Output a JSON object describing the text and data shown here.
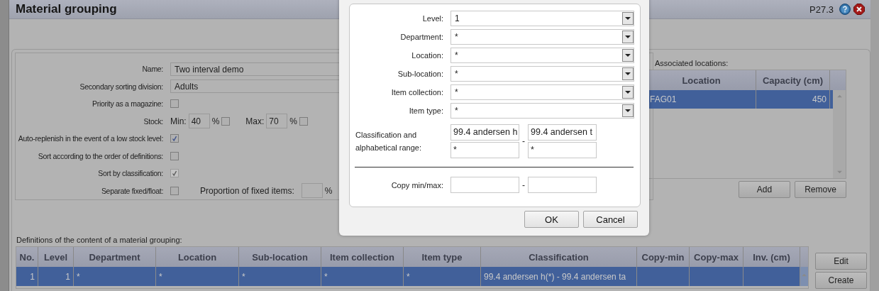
{
  "window": {
    "title": "Material grouping",
    "code": "P27.3"
  },
  "form": [
    {
      "kind": "text",
      "label": "Name:",
      "value": "Two interval demo"
    },
    {
      "kind": "text",
      "label": "Secondary sorting division:",
      "value": "Adults"
    },
    {
      "kind": "check",
      "label": "Priority as a magazine:",
      "checked": false,
      "disabled": false
    },
    {
      "kind": "stock",
      "label": "Stock:",
      "min_label": "Min:",
      "min": "40",
      "min_unit": "%",
      "min_checked": false,
      "max_label": "Max:",
      "max": "70",
      "max_unit": "%",
      "max_checked": false
    },
    {
      "kind": "check",
      "label": "Auto-replenish in the event of a low stock level:",
      "checked": true,
      "disabled": false
    },
    {
      "kind": "check",
      "label": "Sort according to the order of definitions:",
      "checked": false,
      "disabled": false
    },
    {
      "kind": "check",
      "label": "Sort by classification:",
      "checked": true,
      "disabled": true
    },
    {
      "kind": "fixed",
      "label": "Separate fixed/float:",
      "checked": false,
      "disabled": false,
      "proportion_label": "Proportion of fixed items:",
      "unit": "%"
    }
  ],
  "locations": {
    "label": "Associated locations:",
    "columns": [
      "Location",
      "Capacity (cm)"
    ],
    "rows": [
      {
        "cells": [
          "FAG01",
          "450"
        ],
        "selected": true
      }
    ],
    "buttons": [
      "Add",
      "Remove"
    ]
  },
  "definitions": {
    "label": "Definitions of the content of a material grouping:",
    "columns": [
      "No.",
      "Level",
      "Department",
      "Location",
      "Sub-location",
      "Item collection",
      "Item type",
      "Classification",
      "Copy-min",
      "Copy-max",
      "Inv. (cm)"
    ],
    "rows": [
      {
        "cells": [
          "1",
          "1",
          "*",
          "*",
          "*",
          "*",
          "*",
          "99.4 andersen h(*) - 99.4 andersen ta"
        ],
        "selected": true
      }
    ],
    "buttons": [
      "Edit",
      "Create"
    ]
  },
  "dialog": {
    "selects": [
      {
        "label": "Level:",
        "value": "1"
      },
      {
        "label": "Department:",
        "value": "*"
      },
      {
        "label": "Location:",
        "value": "*"
      },
      {
        "label": "Sub-location:",
        "value": "*"
      },
      {
        "label": "Item collection:",
        "value": "*"
      },
      {
        "label": "Item type:",
        "value": "*"
      }
    ],
    "range_label": "Classification and alphabetical range:",
    "range_from": [
      "99.4 andersen h",
      "*"
    ],
    "range_to": [
      "99.4 andersen t",
      "*"
    ],
    "range_separator": "-",
    "copy_label": "Copy min/max:",
    "copy_separator": "-",
    "buttons": [
      "OK",
      "Cancel"
    ]
  }
}
